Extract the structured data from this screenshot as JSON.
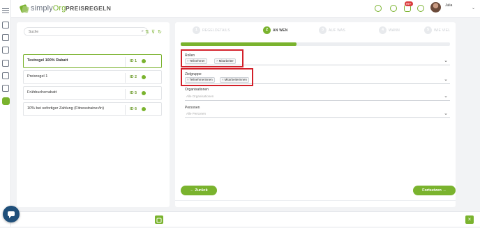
{
  "header": {
    "logo_text_a": "simply",
    "logo_text_b": "Org",
    "page_title": "PREISREGELN",
    "notification_badge": "99+",
    "user_name": "Julia",
    "brand_color": "#7ab32e"
  },
  "left": {
    "search_placeholder": "Suche",
    "rules": [
      {
        "name": "Testregel 100% Rabatt",
        "id": "ID 1"
      },
      {
        "name": "Preisregel 1",
        "id": "ID 2"
      },
      {
        "name": "Frühbucherrabatt",
        "id": "ID 5"
      },
      {
        "name": "10% bei sofortiger Zahlung (Fitnesstrainer/in)",
        "id": "ID 6"
      }
    ]
  },
  "steps": [
    {
      "number": "1",
      "label": "REGELDETAILS"
    },
    {
      "number": "2",
      "label": "AN WEN"
    },
    {
      "number": "3",
      "label": "AUF WAS"
    },
    {
      "number": "4",
      "label": "WANN"
    },
    {
      "number": "5",
      "label": "WIE VIEL"
    }
  ],
  "progress": 0.43,
  "fields": {
    "rollen": {
      "label": "Rollen",
      "chips": [
        "Teilnehmer",
        "Mitarbeiter"
      ]
    },
    "zielgruppe": {
      "label": "Zielgruppe",
      "chips": [
        "Teilnehmerinnen",
        "Mitarbeiterinnen"
      ]
    },
    "organisationen": {
      "label": "Organisationen",
      "placeholder": "Alle Organisationen"
    },
    "personen": {
      "label": "Personen",
      "placeholder": "Alle Personen"
    }
  },
  "buttons": {
    "back": "← Zurück",
    "next": "Fortsetzen →"
  },
  "icons": {
    "chip_remove": "×",
    "chevron": "⌄",
    "close": "×",
    "search": "⌕",
    "sort": "⇅",
    "filter": "⊽",
    "refresh": "↻"
  }
}
